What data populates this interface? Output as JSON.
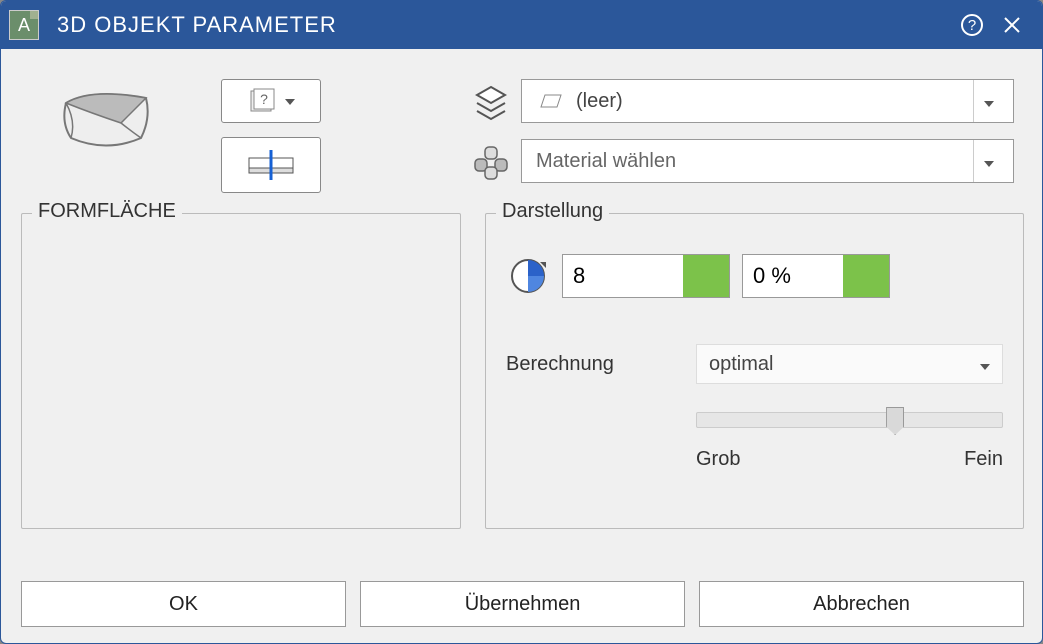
{
  "window": {
    "title": "3D OBJEKT PARAMETER"
  },
  "layer_dropdown": {
    "label": "(leer)"
  },
  "material_dropdown": {
    "placeholder": "Material wählen"
  },
  "group_form": {
    "title": "FORMFLÄCHE"
  },
  "group_display": {
    "title": "Darstellung",
    "value1": "8",
    "value2": "0 %",
    "color1": "#7cc24a",
    "color2": "#7cc24a",
    "calc_label": "Berechnung",
    "calc_value": "optimal",
    "slider_min_label": "Grob",
    "slider_max_label": "Fein",
    "slider_position_percent": 62
  },
  "buttons": {
    "ok": "OK",
    "apply": "Übernehmen",
    "cancel": "Abbrechen"
  },
  "icons": {
    "app": "A",
    "help": "?",
    "close": "✕"
  }
}
